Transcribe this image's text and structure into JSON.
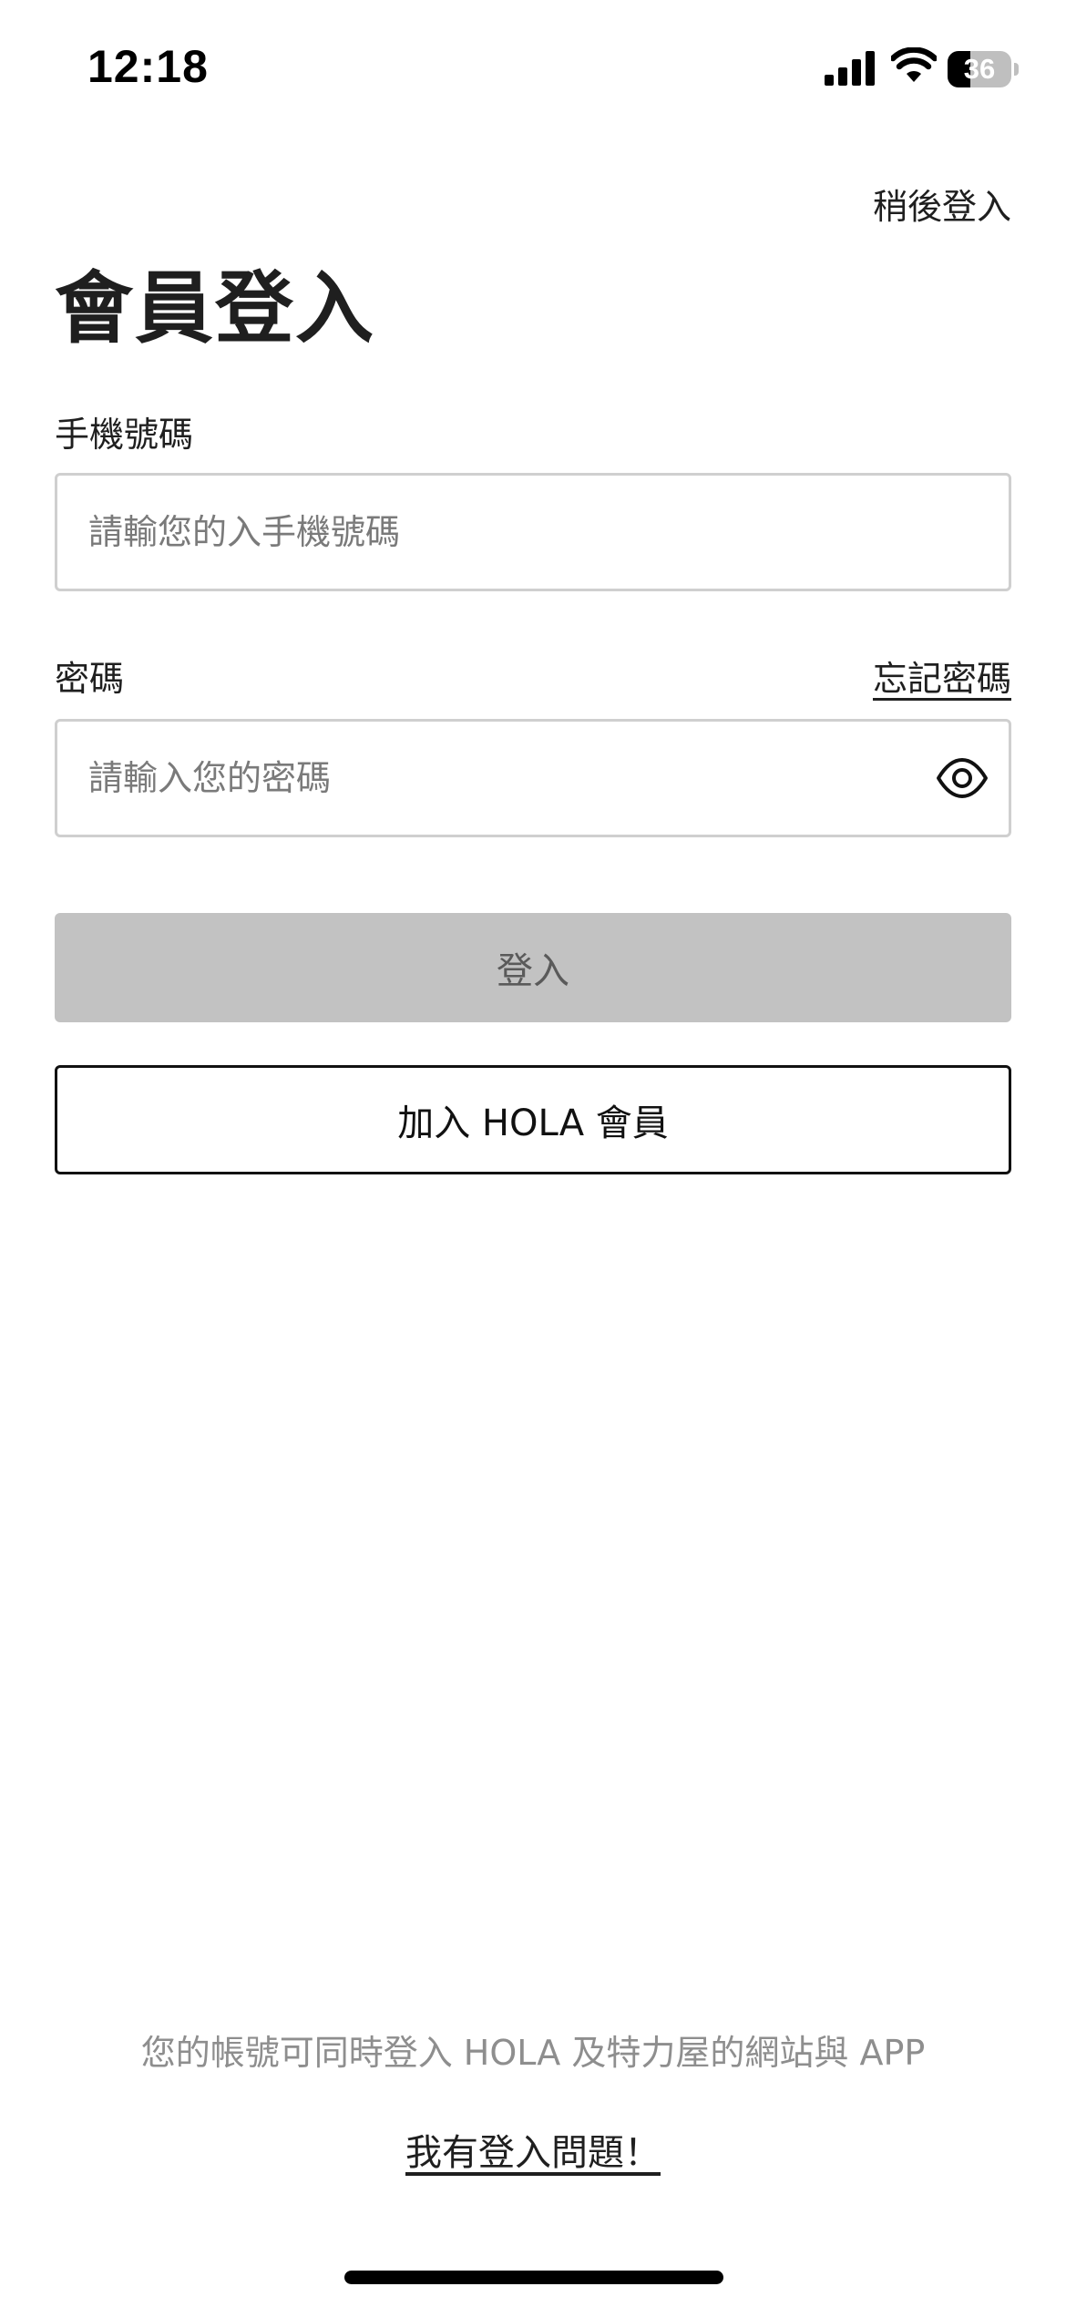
{
  "status_bar": {
    "time": "12:18",
    "battery_level": "36",
    "battery_fraction": 0.36,
    "icons": [
      "signal-bars-icon",
      "wifi-icon",
      "battery-icon"
    ]
  },
  "header": {
    "skip_label": "稍後登入",
    "title": "會員登入"
  },
  "phone_field": {
    "label": "手機號碼",
    "placeholder": "請輸您的入手機號碼",
    "value": ""
  },
  "password_field": {
    "label": "密碼",
    "forgot_label": "忘記密碼",
    "placeholder": "請輸入您的密碼",
    "value": "",
    "toggle_icon": "eye-icon"
  },
  "actions": {
    "login_label": "登入",
    "join_label": "加入 HOLA 會員"
  },
  "footer": {
    "note": "您的帳號可同時登入 HOLA 及特力屋的網站與 APP",
    "help_label": "我有登入問題！"
  },
  "colors": {
    "text": "#1f1f1f",
    "input_border": "#cfcfcf",
    "login_disabled_bg": "#c2c2c2",
    "login_disabled_text": "#5a5a5a",
    "footer_note": "#8e8e8e"
  }
}
